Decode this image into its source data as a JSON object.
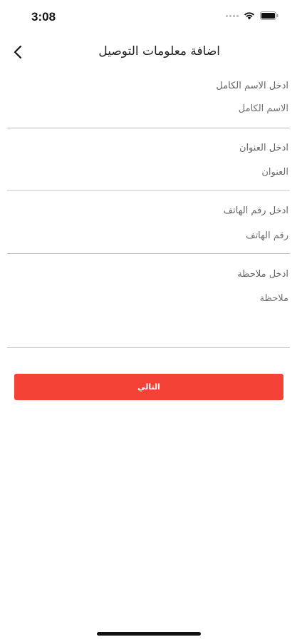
{
  "status_bar": {
    "time": "3:08"
  },
  "header": {
    "title": "اضافة معلومات التوصيل",
    "back_icon": "chevron-left-icon"
  },
  "form": {
    "fields": [
      {
        "label": "ادخل الاسم الكامل",
        "placeholder": "الاسم الكامل",
        "value": ""
      },
      {
        "label": "ادخل العنوان",
        "placeholder": "العنوان",
        "value": ""
      },
      {
        "label": "ادخل رقم الهاتف",
        "placeholder": "رقم الهاتف",
        "value": ""
      },
      {
        "label": "ادخل ملاحظة",
        "placeholder": "ملاحظة",
        "value": ""
      }
    ],
    "next_label": "التالي"
  },
  "colors": {
    "accent": "#f44336",
    "divider": "#bdbdbd",
    "label": "#666666"
  }
}
